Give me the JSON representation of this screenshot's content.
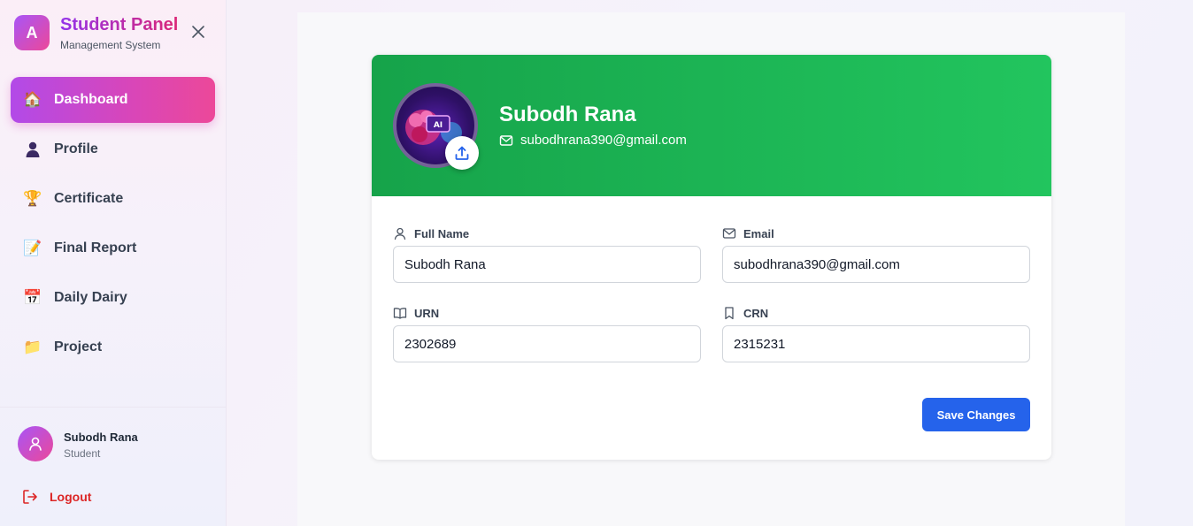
{
  "sidebar": {
    "brand": {
      "logo_letter": "A",
      "title": "Student Panel",
      "subtitle": "Management System"
    },
    "items": [
      {
        "label": "Dashboard",
        "icon": "house-icon",
        "active": true
      },
      {
        "label": "Profile",
        "icon": "person-icon"
      },
      {
        "label": "Certificate",
        "icon": "trophy-icon"
      },
      {
        "label": "Final Report",
        "icon": "memo-icon"
      },
      {
        "label": "Daily Dairy",
        "icon": "calendar-icon"
      },
      {
        "label": "Project",
        "icon": "folder-icon"
      }
    ],
    "user": {
      "name": "Subodh Rana",
      "role": "Student"
    },
    "logout_label": "Logout"
  },
  "profile": {
    "name": "Subodh Rana",
    "email": "subodhrana390@gmail.com",
    "avatar_text": "AI"
  },
  "form": {
    "full_name_label": "Full Name",
    "full_name_value": "Subodh Rana",
    "email_label": "Email",
    "email_value": "subodhrana390@gmail.com",
    "urn_label": "URN",
    "urn_value": "2302689",
    "crn_label": "CRN",
    "crn_value": "2315231",
    "save_label": "Save Changes"
  },
  "colors": {
    "accent_gradient_start": "#a855f7",
    "accent_gradient_end": "#ec4899",
    "header_green": "#22c55e",
    "primary_button": "#2563eb",
    "logout_red": "#dc2626"
  }
}
